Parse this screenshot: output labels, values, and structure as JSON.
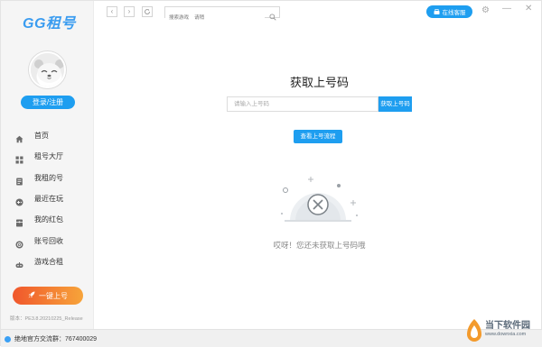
{
  "app": {
    "logo": "GG租号",
    "login_label": "登录/注册",
    "version": "版本：PE3.8.20210225_Release",
    "primary_label": "一键上号"
  },
  "sidebar": {
    "items": [
      {
        "label": "首页",
        "icon": "home-icon"
      },
      {
        "label": "租号大厅",
        "icon": "grid-icon"
      },
      {
        "label": "我租的号",
        "icon": "document-icon"
      },
      {
        "label": "最近在玩",
        "icon": "gamepad-icon"
      },
      {
        "label": "我的红包",
        "icon": "wallet-icon"
      },
      {
        "label": "账号回收",
        "icon": "recycle-icon"
      },
      {
        "label": "游戏合租",
        "icon": "controller-icon"
      }
    ]
  },
  "topbar": {
    "search_placeholder": "搜索游戏    请稍",
    "support_label": "在线客服"
  },
  "main": {
    "title": "获取上号码",
    "input_placeholder": "请输入上号码",
    "get_label": "获取上号码",
    "flow_label": "查看上号流程",
    "empty_text": "哎呀！您还未获取上号码哦"
  },
  "footer": {
    "qq_group": "绝地官方交流群：767400029"
  },
  "watermark": {
    "line1": "当下软件园",
    "line2": "www.downxia.com"
  },
  "colors": {
    "accent": "#1e9ef0",
    "primary_gradient_start": "#f0572c",
    "primary_gradient_end": "#f7a43a",
    "sidebar_bg": "#f5f5f5"
  }
}
